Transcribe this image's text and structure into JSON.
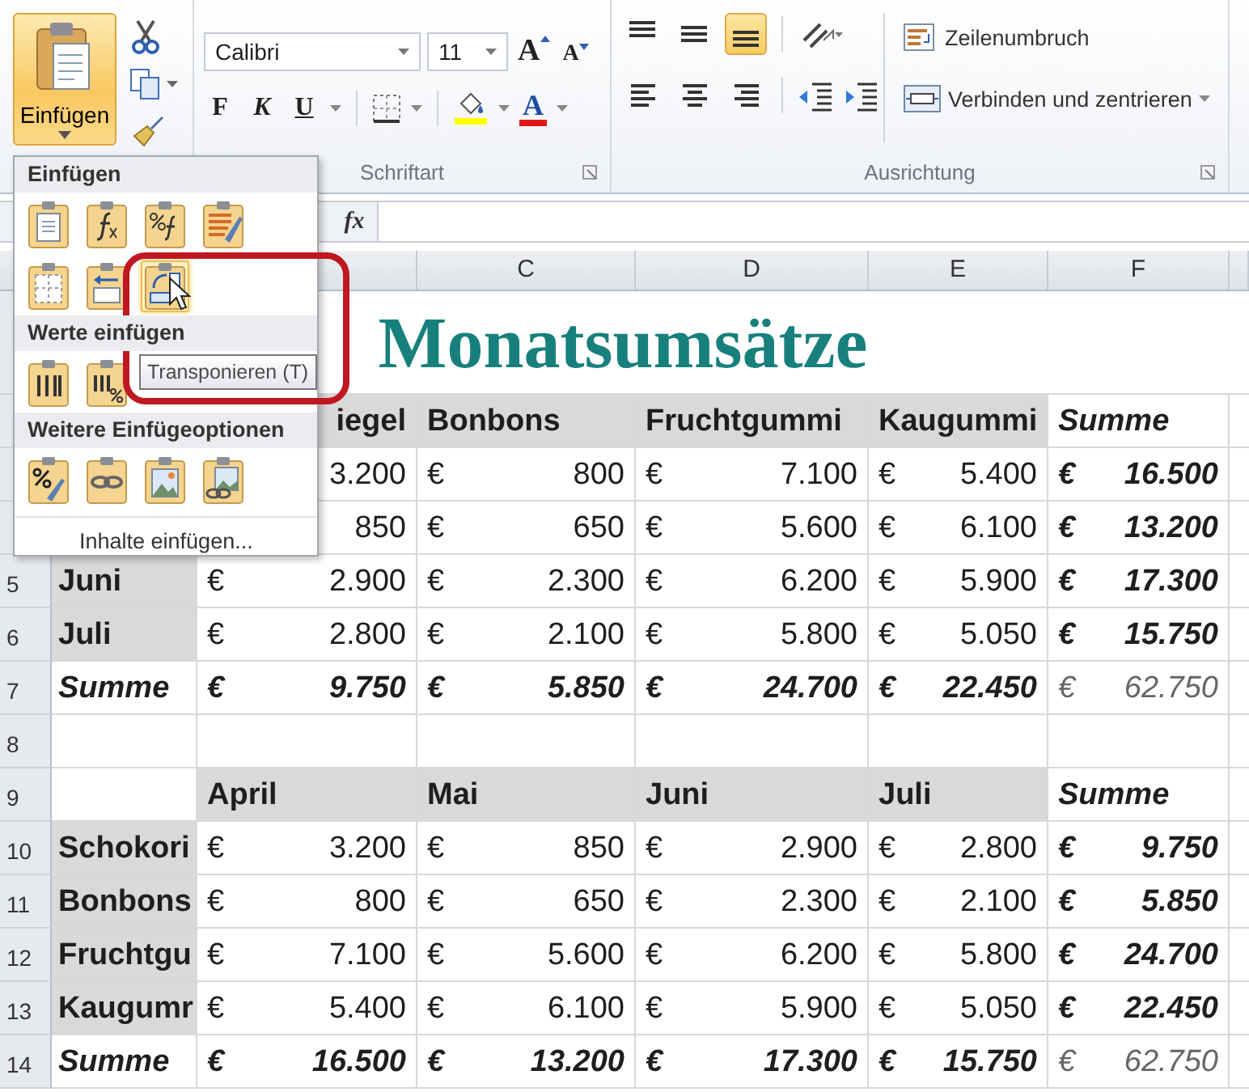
{
  "ribbon": {
    "paste_button": {
      "label": "Einfügen",
      "expanded": true
    },
    "font_group": {
      "font_name": "Calibri",
      "font_size": "11",
      "grow_label": "A",
      "shrink_label": "A",
      "styles": [
        {
          "kind": "bold",
          "label": "F"
        },
        {
          "kind": "italic",
          "label": "K"
        },
        {
          "kind": "underline",
          "label": "U"
        }
      ],
      "font_color_label": "A",
      "label": "Schriftart"
    },
    "alignment_group": {
      "vertical": [
        {
          "kind": "top",
          "selected": false
        },
        {
          "kind": "middle",
          "selected": false
        },
        {
          "kind": "bottom",
          "selected": true
        }
      ],
      "horizontal": [
        {
          "kind": "left",
          "selected": false
        },
        {
          "kind": "center",
          "selected": false
        },
        {
          "kind": "right",
          "selected": false
        }
      ],
      "wrap_button": "Zeilenumbruch",
      "merge_button": "Verbinden und zentrieren",
      "label": "Ausrichtung"
    }
  },
  "formula_bar": {
    "function_label": "fx"
  },
  "grid": {
    "columns": [
      null,
      null,
      "C",
      "D",
      "E",
      "F"
    ],
    "rows": [
      {
        "cells": [
          null,
          {
            "kind": "title",
            "text": "Monatsumsätze"
          },
          null
        ]
      },
      {
        "cells": [
          null,
          {
            "kind": "header",
            "text": "iegel",
            "covered": true
          },
          {
            "kind": "header",
            "text": "Bonbons"
          },
          {
            "kind": "header",
            "text": "Fruchtgummi"
          },
          {
            "kind": "header",
            "text": "Kaugummi"
          },
          {
            "kind": "header-sum",
            "text": "Summe"
          }
        ]
      },
      {
        "cells": [
          null,
          {
            "kind": "money",
            "amount": "3.200"
          },
          {
            "kind": "money",
            "currency": "€",
            "amount": "800"
          },
          {
            "kind": "money",
            "currency": "€",
            "amount": "7.100"
          },
          {
            "kind": "money",
            "currency": "€",
            "amount": "5.400"
          },
          {
            "kind": "money-sum",
            "currency": "€",
            "amount": "16.500"
          }
        ]
      },
      {
        "cells": [
          null,
          {
            "kind": "money",
            "amount": "850"
          },
          {
            "kind": "money",
            "currency": "€",
            "amount": "650"
          },
          {
            "kind": "money",
            "currency": "€",
            "amount": "5.600"
          },
          {
            "kind": "money",
            "currency": "€",
            "amount": "6.100"
          },
          {
            "kind": "money-sum",
            "currency": "€",
            "amount": "13.200"
          }
        ]
      },
      {
        "number": "5",
        "cells": [
          {
            "kind": "label",
            "text": "Juni"
          },
          {
            "kind": "money",
            "currency": "€",
            "amount": "2.900"
          },
          {
            "kind": "money",
            "currency": "€",
            "amount": "2.300"
          },
          {
            "kind": "money",
            "currency": "€",
            "amount": "6.200"
          },
          {
            "kind": "money",
            "currency": "€",
            "amount": "5.900"
          },
          {
            "kind": "money-sum",
            "currency": "€",
            "amount": "17.300"
          }
        ]
      },
      {
        "number": "6",
        "cells": [
          {
            "kind": "label",
            "text": "Juli"
          },
          {
            "kind": "money",
            "currency": "€",
            "amount": "2.800"
          },
          {
            "kind": "money",
            "currency": "€",
            "amount": "2.100"
          },
          {
            "kind": "money",
            "currency": "€",
            "amount": "5.800"
          },
          {
            "kind": "money",
            "currency": "€",
            "amount": "5.050"
          },
          {
            "kind": "money-sum",
            "currency": "€",
            "amount": "15.750"
          }
        ]
      },
      {
        "number": "7",
        "cells": [
          {
            "kind": "label-sum",
            "text": "Summe"
          },
          {
            "kind": "money-sum",
            "currency": "€",
            "amount": "9.750"
          },
          {
            "kind": "money-sum",
            "currency": "€",
            "amount": "5.850"
          },
          {
            "kind": "money-sum",
            "currency": "€",
            "amount": "24.700"
          },
          {
            "kind": "money-sum",
            "currency": "€",
            "amount": "22.450"
          },
          {
            "kind": "money-total",
            "currency": "€",
            "amount": "62.750"
          }
        ]
      },
      {
        "number": "8",
        "cells": [
          null,
          null,
          null,
          null,
          null,
          null
        ]
      },
      {
        "number": "9",
        "cells": [
          null,
          {
            "kind": "header",
            "text": "April"
          },
          {
            "kind": "header",
            "text": "Mai"
          },
          {
            "kind": "header",
            "text": "Juni"
          },
          {
            "kind": "header",
            "text": "Juli"
          },
          {
            "kind": "header-sum",
            "text": "Summe"
          }
        ]
      },
      {
        "number": "10",
        "cells": [
          {
            "kind": "label",
            "text": "Schokori"
          },
          {
            "kind": "money",
            "currency": "€",
            "amount": "3.200"
          },
          {
            "kind": "money",
            "currency": "€",
            "amount": "850"
          },
          {
            "kind": "money",
            "currency": "€",
            "amount": "2.900"
          },
          {
            "kind": "money",
            "currency": "€",
            "amount": "2.800"
          },
          {
            "kind": "money-sum",
            "currency": "€",
            "amount": "9.750"
          }
        ]
      },
      {
        "number": "11",
        "cells": [
          {
            "kind": "label",
            "text": "Bonbons"
          },
          {
            "kind": "money",
            "currency": "€",
            "amount": "800"
          },
          {
            "kind": "money",
            "currency": "€",
            "amount": "650"
          },
          {
            "kind": "money",
            "currency": "€",
            "amount": "2.300"
          },
          {
            "kind": "money",
            "currency": "€",
            "amount": "2.100"
          },
          {
            "kind": "money-sum",
            "currency": "€",
            "amount": "5.850"
          }
        ]
      },
      {
        "number": "12",
        "cells": [
          {
            "kind": "label",
            "text": "Fruchtgu"
          },
          {
            "kind": "money",
            "currency": "€",
            "amount": "7.100"
          },
          {
            "kind": "money",
            "currency": "€",
            "amount": "5.600"
          },
          {
            "kind": "money",
            "currency": "€",
            "amount": "6.200"
          },
          {
            "kind": "money",
            "currency": "€",
            "amount": "5.800"
          },
          {
            "kind": "money-sum",
            "currency": "€",
            "amount": "24.700"
          }
        ]
      },
      {
        "number": "13",
        "cells": [
          {
            "kind": "label",
            "text": "Kaugumr"
          },
          {
            "kind": "money",
            "currency": "€",
            "amount": "5.400"
          },
          {
            "kind": "money",
            "currency": "€",
            "amount": "6.100"
          },
          {
            "kind": "money",
            "currency": "€",
            "amount": "5.900"
          },
          {
            "kind": "money",
            "currency": "€",
            "amount": "5.050"
          },
          {
            "kind": "money-sum",
            "currency": "€",
            "amount": "22.450"
          }
        ]
      },
      {
        "number": "14",
        "cells": [
          {
            "kind": "label-sum",
            "text": "Summe"
          },
          {
            "kind": "money-sum",
            "currency": "€",
            "amount": "16.500"
          },
          {
            "kind": "money-sum",
            "currency": "€",
            "amount": "13.200"
          },
          {
            "kind": "money-sum",
            "currency": "€",
            "amount": "17.300"
          },
          {
            "kind": "money-sum",
            "currency": "€",
            "amount": "15.750"
          },
          {
            "kind": "money-total",
            "currency": "€",
            "amount": "62.750"
          }
        ]
      }
    ]
  },
  "paste_menu": {
    "sections": [
      {
        "title": "Einfügen",
        "rows": [
          [
            {
              "kind": "document",
              "selected": false
            },
            {
              "kind": "formula",
              "selected": false
            },
            {
              "kind": "formula-number",
              "selected": false
            },
            {
              "kind": "source-format",
              "selected": false
            }
          ],
          [
            {
              "kind": "no-borders",
              "selected": false
            },
            {
              "kind": "column-width",
              "selected": false
            },
            {
              "kind": "transpose",
              "selected": true
            }
          ]
        ]
      },
      {
        "title": "Werte einfügen",
        "rows": [
          [
            {
              "kind": "values",
              "selected": false
            },
            {
              "kind": "values-number",
              "selected": false
            }
          ]
        ]
      },
      {
        "title": "Weitere Einfügeoptionen",
        "rows": [
          [
            {
              "kind": "formatting",
              "selected": false
            },
            {
              "kind": "link",
              "selected": false
            },
            {
              "kind": "picture",
              "selected": false
            },
            {
              "kind": "linked-picture",
              "selected": false
            }
          ]
        ]
      }
    ],
    "footer": "Inhalte einfügen...",
    "tooltip": "Transponieren (T)"
  }
}
